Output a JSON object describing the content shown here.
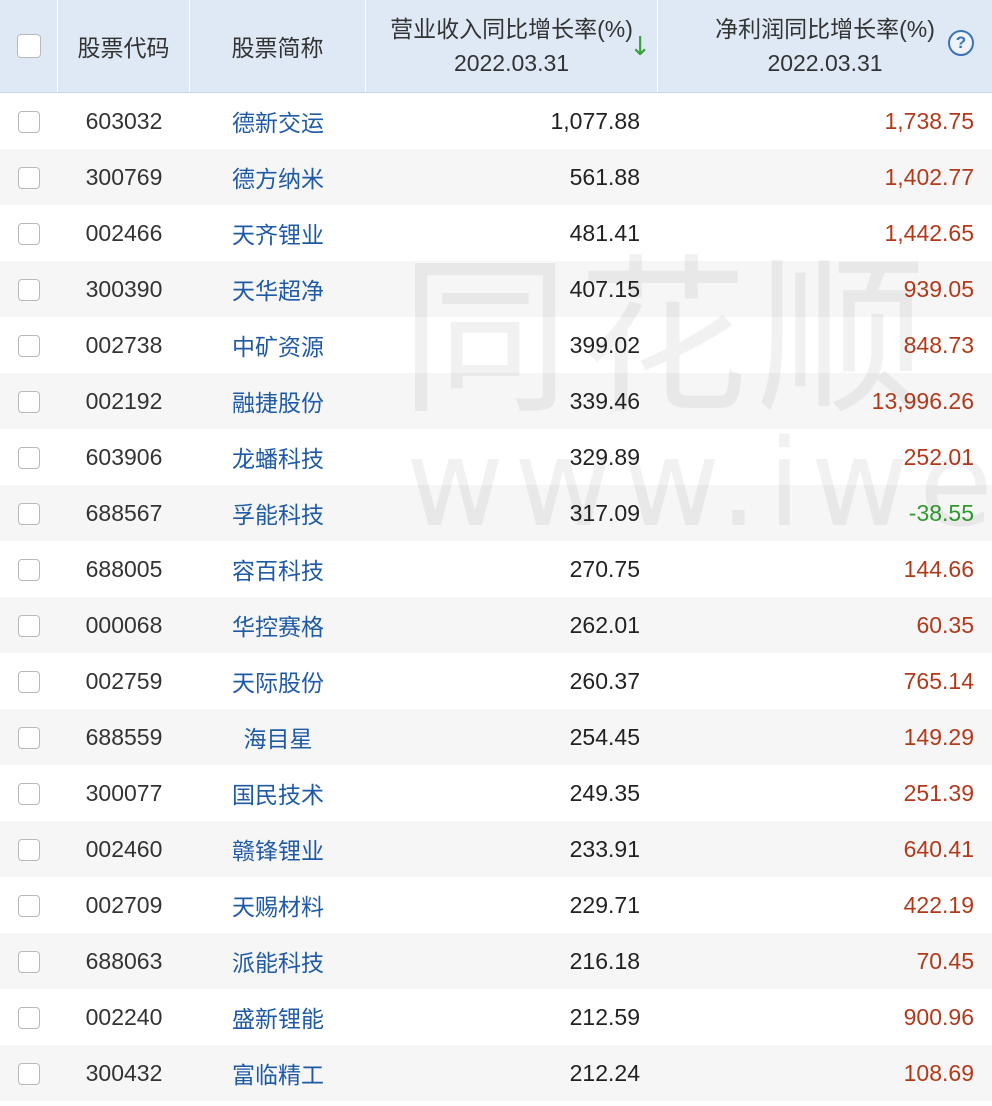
{
  "header": {
    "code": "股票代码",
    "name": "股票简称",
    "revenue_line1": "营业收入同比增长率(%)",
    "revenue_line2": "2022.03.31",
    "sort_glyph": "↓",
    "netprofit_line1": "净利润同比增长率(%)",
    "netprofit_line2": "2022.03.31",
    "help_glyph": "?"
  },
  "watermark": {
    "cn": "同花顺",
    "url": "www.iwen"
  },
  "colors": {
    "header_bg": "#dfe9f6",
    "link_blue": "#1f5aa6",
    "up_red": "#b23a1b",
    "down_green": "#2e9b2e",
    "help_blue": "#3b72b8"
  },
  "icons": {
    "sort": "sort-down-arrow-icon",
    "help": "question-circle-icon"
  },
  "rows": [
    {
      "code": "603032",
      "name": "德新交运",
      "revenue": "1,077.88",
      "netprofit": "1,738.75"
    },
    {
      "code": "300769",
      "name": "德方纳米",
      "revenue": "561.88",
      "netprofit": "1,402.77"
    },
    {
      "code": "002466",
      "name": "天齐锂业",
      "revenue": "481.41",
      "netprofit": "1,442.65"
    },
    {
      "code": "300390",
      "name": "天华超净",
      "revenue": "407.15",
      "netprofit": "939.05"
    },
    {
      "code": "002738",
      "name": "中矿资源",
      "revenue": "399.02",
      "netprofit": "848.73"
    },
    {
      "code": "002192",
      "name": "融捷股份",
      "revenue": "339.46",
      "netprofit": "13,996.26"
    },
    {
      "code": "603906",
      "name": "龙蟠科技",
      "revenue": "329.89",
      "netprofit": "252.01"
    },
    {
      "code": "688567",
      "name": "孚能科技",
      "revenue": "317.09",
      "netprofit": "-38.55"
    },
    {
      "code": "688005",
      "name": "容百科技",
      "revenue": "270.75",
      "netprofit": "144.66"
    },
    {
      "code": "000068",
      "name": "华控赛格",
      "revenue": "262.01",
      "netprofit": "60.35"
    },
    {
      "code": "002759",
      "name": "天际股份",
      "revenue": "260.37",
      "netprofit": "765.14"
    },
    {
      "code": "688559",
      "name": "海目星",
      "revenue": "254.45",
      "netprofit": "149.29"
    },
    {
      "code": "300077",
      "name": "国民技术",
      "revenue": "249.35",
      "netprofit": "251.39"
    },
    {
      "code": "002460",
      "name": "赣锋锂业",
      "revenue": "233.91",
      "netprofit": "640.41"
    },
    {
      "code": "002709",
      "name": "天赐材料",
      "revenue": "229.71",
      "netprofit": "422.19"
    },
    {
      "code": "688063",
      "name": "派能科技",
      "revenue": "216.18",
      "netprofit": "70.45"
    },
    {
      "code": "002240",
      "name": "盛新锂能",
      "revenue": "212.59",
      "netprofit": "900.96"
    },
    {
      "code": "300432",
      "name": "富临精工",
      "revenue": "212.24",
      "netprofit": "108.69"
    }
  ]
}
